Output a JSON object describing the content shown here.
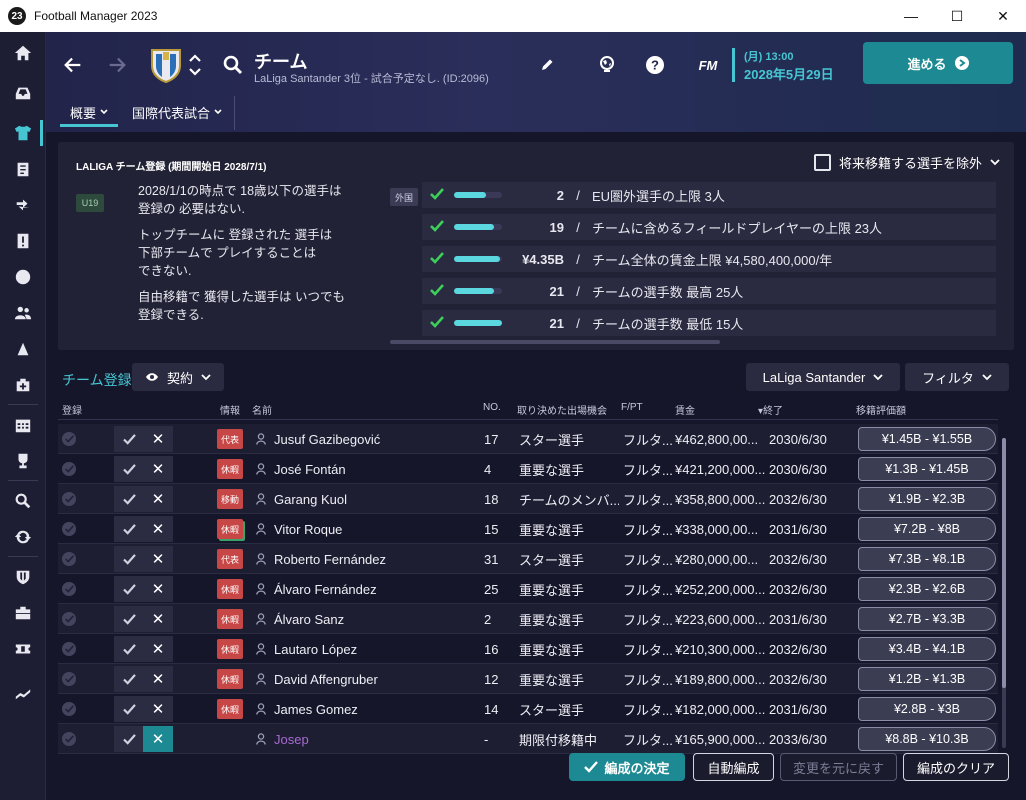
{
  "window": {
    "app_icon_text": "23",
    "title": "Football Manager 2023",
    "min": "—",
    "max": "☐",
    "close": "✕"
  },
  "sidebar": {
    "items": [
      "home-icon",
      "inbox-icon",
      "squad-icon",
      "tactics-icon",
      "transfers-icon",
      "alerts-icon",
      "match-icon",
      "staff-icon",
      "training-icon",
      "medical-icon",
      "schedule-icon",
      "competitions-icon",
      "scouting-icon",
      "refresh-icon",
      "club-icon",
      "finance-icon",
      "tickets-icon",
      "trend-icon"
    ]
  },
  "header": {
    "title": "チーム",
    "subtitle": "LaLiga Santander 3位 - 試合予定なし. (ID:2096)",
    "fm_label": "FM",
    "date_time": "(月) 13:00",
    "date": "2028年5月29日",
    "continue_label": "進める",
    "tabs": [
      {
        "label": "概要"
      },
      {
        "label": "国際代表試合"
      }
    ]
  },
  "panel": {
    "title": "LALIGA チーム登録 (期間開始日 2028/7/1)",
    "exclude_label": "将来移籍する選手を除外",
    "u19_tag": "U19",
    "notes": [
      "2028/1/1の時点で 18歳以下の選手は\n登録の 必要はない.",
      "トップチームに 登録された 選手は\n下部チームで プレイすることは\nできない.",
      "自由移籍で 獲得した選手は いつでも\n登録できる."
    ],
    "foreign_tag": "外国",
    "rules": [
      {
        "value": "2",
        "slash": "/",
        "text": "EU圏外選手の上限 3人",
        "fill": 0.67
      },
      {
        "value": "19",
        "slash": "/",
        "text": "チームに含めるフィールドプレイヤーの上限 23人",
        "fill": 0.83
      },
      {
        "value": "¥4.35B",
        "slash": "/",
        "text": "チーム全体の賃金上限 ¥4,580,400,000/年",
        "fill": 0.95
      },
      {
        "value": "21",
        "slash": "/",
        "text": "チームの選手数 最高 25人",
        "fill": 0.84
      },
      {
        "value": "21",
        "slash": "/",
        "text": "チームの選手数 最低 15人",
        "fill": 1.0
      }
    ]
  },
  "toolbar": {
    "registration_label": "チーム登録",
    "contract_label": "契約",
    "league_label": "LaLiga Santander",
    "filter_label": "フィルタ"
  },
  "table": {
    "headers": {
      "reg": "登録",
      "info": "情報",
      "name": "名前",
      "no": "NO.",
      "playing_time": "取り決めた出場機会",
      "fpt": "F/PT",
      "wage": "賃金",
      "expires": "▾終了",
      "value": "移籍評価額"
    },
    "rows": [
      {
        "badge": "代表",
        "name": "Jusuf Gazibegović",
        "no": "17",
        "role": "スター選手",
        "fpt": "フルタ...",
        "wage": "¥462,800,00...",
        "expires": "2030/6/30",
        "value": "¥1.45B - ¥1.55B"
      },
      {
        "badge": "休暇",
        "name": "José Fontán",
        "no": "4",
        "role": "重要な選手",
        "fpt": "フルタ...",
        "wage": "¥421,200,000...",
        "expires": "2030/6/30",
        "value": "¥1.3B - ¥1.45B"
      },
      {
        "badge": "移動",
        "name": "Garang Kuol",
        "no": "18",
        "role": "チームのメンバ...",
        "fpt": "フルタ...",
        "wage": "¥358,800,000...",
        "expires": "2032/6/30",
        "value": "¥1.9B - ¥2.3B"
      },
      {
        "badge": "休暇",
        "name": "Vitor Roque",
        "no": "15",
        "role": "重要な選手",
        "fpt": "フルタ...",
        "wage": "¥338,000,00...",
        "expires": "2031/6/30",
        "value": "¥7.2B - ¥8B"
      },
      {
        "badge": "代表",
        "name": "Roberto Fernández",
        "no": "31",
        "role": "スター選手",
        "fpt": "フルタ...",
        "wage": "¥280,000,00...",
        "expires": "2032/6/30",
        "value": "¥7.3B - ¥8.1B"
      },
      {
        "badge": "休暇",
        "name": "Álvaro Fernández",
        "no": "25",
        "role": "重要な選手",
        "fpt": "フルタ...",
        "wage": "¥252,200,000...",
        "expires": "2032/6/30",
        "value": "¥2.3B - ¥2.6B"
      },
      {
        "badge": "休暇",
        "name": "Álvaro Sanz",
        "no": "2",
        "role": "重要な選手",
        "fpt": "フルタ...",
        "wage": "¥223,600,000...",
        "expires": "2031/6/30",
        "value": "¥2.7B - ¥3.3B"
      },
      {
        "badge": "休暇",
        "name": "Lautaro López",
        "no": "16",
        "role": "重要な選手",
        "fpt": "フルタ...",
        "wage": "¥210,300,000...",
        "expires": "2032/6/30",
        "value": "¥3.4B - ¥4.1B"
      },
      {
        "badge": "休暇",
        "name": "David Affengruber",
        "no": "12",
        "role": "重要な選手",
        "fpt": "フルタ...",
        "wage": "¥189,800,000...",
        "expires": "2032/6/30",
        "value": "¥1.2B - ¥1.3B"
      },
      {
        "badge": "休暇",
        "name": "James Gomez",
        "no": "14",
        "role": "スター選手",
        "fpt": "フルタ...",
        "wage": "¥182,000,000...",
        "expires": "2031/6/30",
        "value": "¥2.8B - ¥3B"
      },
      {
        "badge": "",
        "name": "Josep",
        "no": "-",
        "role": "期限付移籍中",
        "fpt": "フルタ...",
        "wage": "¥165,900,000...",
        "expires": "2033/6/30",
        "value": "¥8.8B - ¥10.3B"
      }
    ]
  },
  "footer": {
    "confirm_label": "編成の決定",
    "auto_label": "自動編成",
    "revert_label": "変更を元に戻す",
    "clear_label": "編成のクリア"
  },
  "colors": {
    "accent": "#46c6d2",
    "primary_button": "#1d8a93",
    "badge_red": "#c74747",
    "background": "#16162a"
  }
}
